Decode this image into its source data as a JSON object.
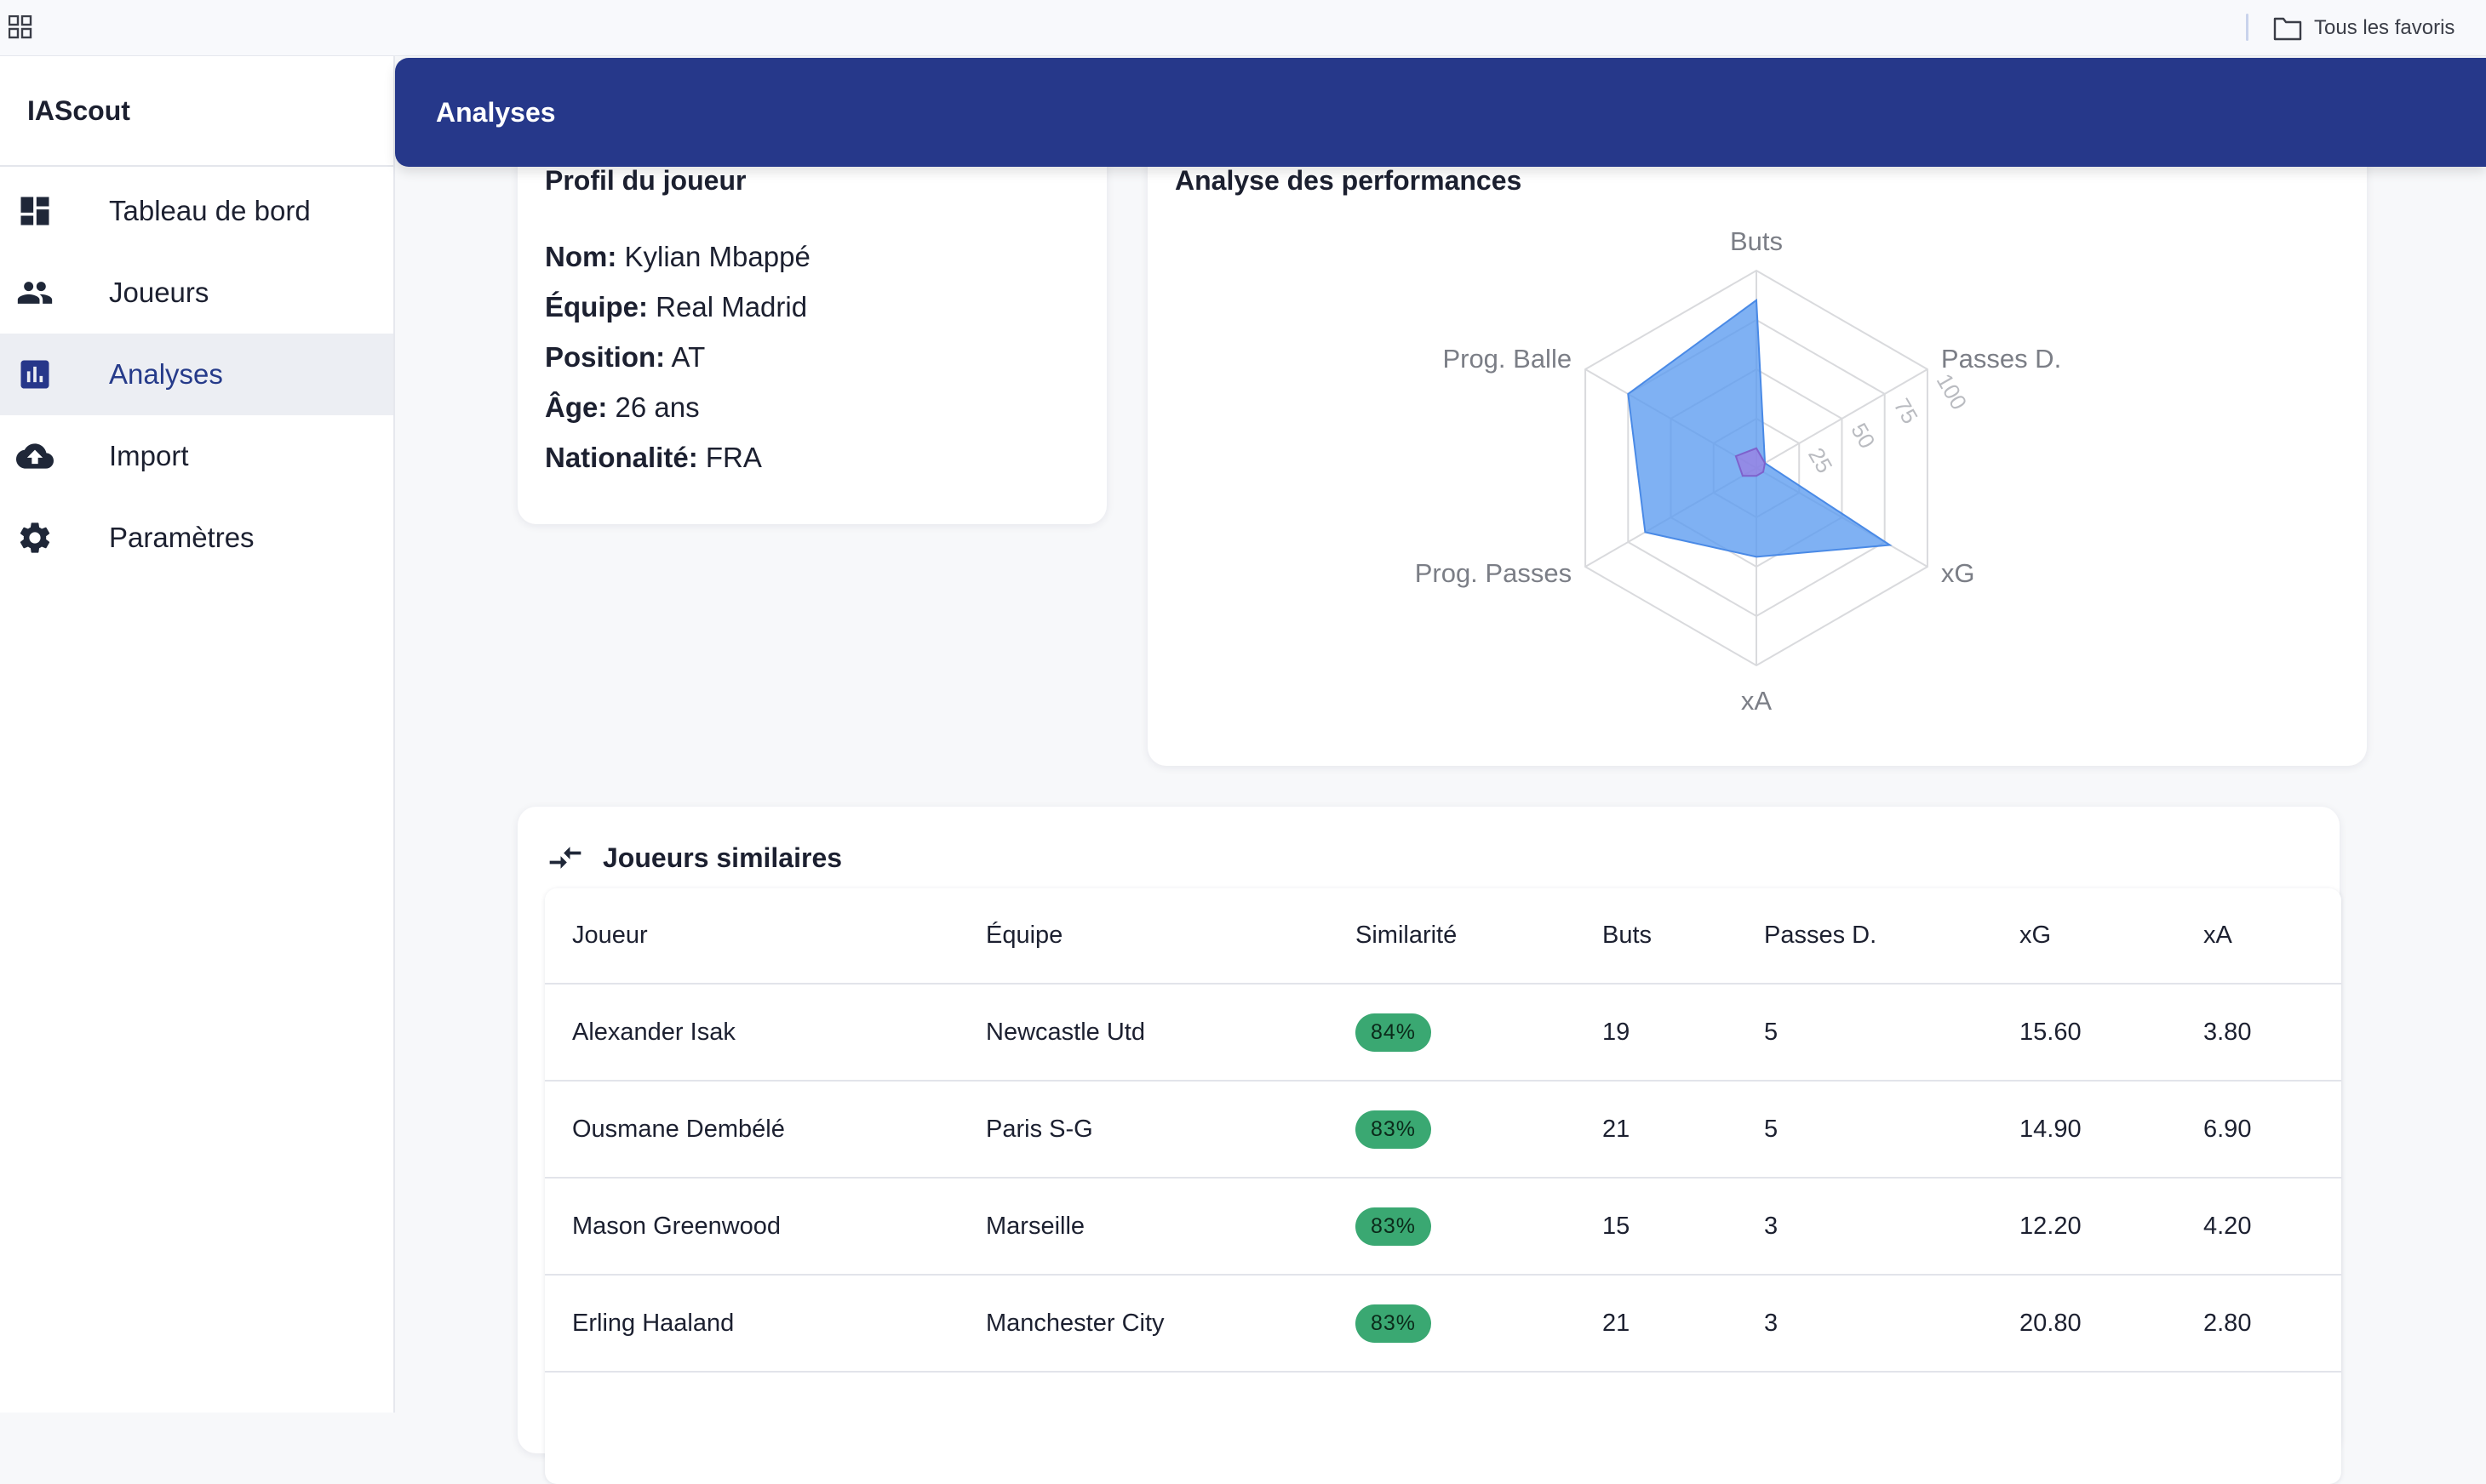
{
  "browser": {
    "bookmarks_folder": "Tous les favoris"
  },
  "sidebar": {
    "brand": "IAScout",
    "items": [
      {
        "label": "Tableau de bord",
        "icon": "dashboard-icon"
      },
      {
        "label": "Joueurs",
        "icon": "people-icon"
      },
      {
        "label": "Analyses",
        "icon": "bar-chart-icon",
        "active": true
      },
      {
        "label": "Import",
        "icon": "cloud-upload-icon"
      },
      {
        "label": "Paramètres",
        "icon": "gear-icon"
      }
    ]
  },
  "header": {
    "title": "Analyses"
  },
  "profile": {
    "title": "Profil du joueur",
    "fields": [
      {
        "label": "Nom:",
        "value": "Kylian Mbappé"
      },
      {
        "label": "Équipe:",
        "value": "Real Madrid"
      },
      {
        "label": "Position:",
        "value": "AT"
      },
      {
        "label": "Âge:",
        "value": "26 ans"
      },
      {
        "label": "Nationalité:",
        "value": "FRA"
      }
    ]
  },
  "performance": {
    "title": "Analyse des performances"
  },
  "chart_data": {
    "type": "radar",
    "axes": [
      "Buts",
      "Passes D.",
      "xG",
      "xA",
      "Prog. Passes",
      "Prog. Balle"
    ],
    "rlim": [
      0,
      100
    ],
    "ticks": [
      "25",
      "50",
      "75",
      "100"
    ],
    "series": [
      {
        "values": [
          85,
          5,
          78,
          45,
          65,
          75
        ],
        "color": "#5b9bef"
      },
      {
        "values": [
          10,
          5,
          4,
          4,
          8,
          12
        ],
        "color": "#9b7be0"
      }
    ]
  },
  "similar": {
    "title": "Joueurs similaires",
    "columns": [
      "Joueur",
      "Équipe",
      "Similarité",
      "Buts",
      "Passes D.",
      "xG",
      "xA"
    ],
    "rows": [
      {
        "player": "Alexander Isak",
        "team": "Newcastle Utd",
        "similarity": "84%",
        "goals": "19",
        "assists": "5",
        "xg": "15.60",
        "xa": "3.80"
      },
      {
        "player": "Ousmane Dembélé",
        "team": "Paris S-G",
        "similarity": "83%",
        "goals": "21",
        "assists": "5",
        "xg": "14.90",
        "xa": "6.90"
      },
      {
        "player": "Mason Greenwood",
        "team": "Marseille",
        "similarity": "83%",
        "goals": "15",
        "assists": "3",
        "xg": "12.20",
        "xa": "4.20"
      },
      {
        "player": "Erling Haaland",
        "team": "Manchester City",
        "similarity": "83%",
        "goals": "21",
        "assists": "3",
        "xg": "20.80",
        "xa": "2.80"
      }
    ]
  },
  "colors": {
    "primary": "#26388a",
    "badge": "#3aa872"
  }
}
